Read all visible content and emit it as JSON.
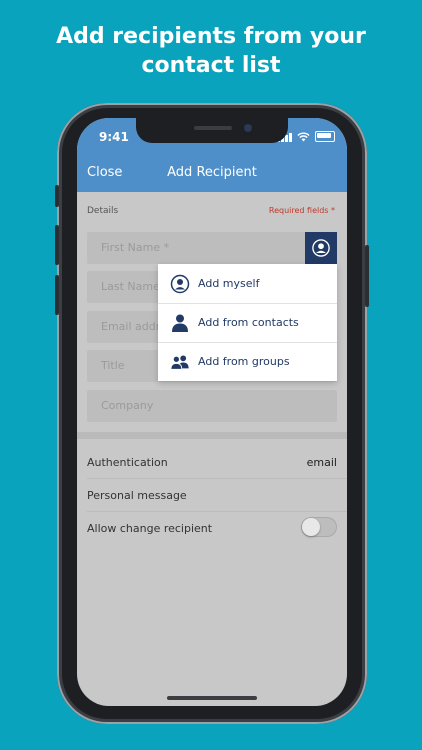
{
  "headline": {
    "line1": "Add recipients from your",
    "line2": "contact list"
  },
  "status_bar": {
    "time": "9:41"
  },
  "nav": {
    "close_label": "Close",
    "title": "Add Recipient"
  },
  "form": {
    "section_label": "Details",
    "required_label": "Required fields *",
    "fields": [
      {
        "placeholder": "First Name *"
      },
      {
        "placeholder": "Last Name"
      },
      {
        "placeholder": "Email address"
      },
      {
        "placeholder": "Title"
      },
      {
        "placeholder": "Company"
      }
    ]
  },
  "popup": {
    "items": [
      {
        "label": "Add myself",
        "icon": "person-circle-icon"
      },
      {
        "label": "Add from contacts",
        "icon": "person-icon"
      },
      {
        "label": "Add from groups",
        "icon": "group-icon"
      }
    ]
  },
  "settings": {
    "authentication_label": "Authentication",
    "authentication_value": "email",
    "personal_message_label": "Personal message",
    "allow_change_label": "Allow change recipient",
    "allow_change_enabled": false
  },
  "colors": {
    "background": "#0aa3bd",
    "nav_bar": "#4f8fc9",
    "accent_dark": "#213a66",
    "required": "#c0392b"
  }
}
